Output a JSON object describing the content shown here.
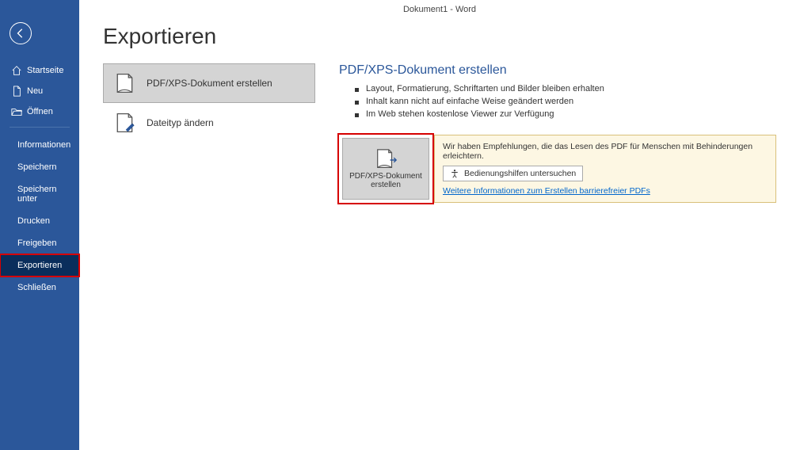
{
  "titlebar": "Dokument1  -  Word",
  "page_title": "Exportieren",
  "sidebar": {
    "top": {
      "home": "Startseite",
      "new": "Neu",
      "open": "Öffnen"
    },
    "items": [
      "Informationen",
      "Speichern",
      "Speichern unter",
      "Drucken",
      "Freigeben",
      "Exportieren",
      "Schließen"
    ]
  },
  "options": {
    "pdfxps": "PDF/XPS-Dokument erstellen",
    "changetype": "Dateityp ändern"
  },
  "right": {
    "title": "PDF/XPS-Dokument erstellen",
    "bullets": [
      "Layout, Formatierung, Schriftarten und Bilder bleiben erhalten",
      "Inhalt kann nicht auf einfache Weise geändert werden",
      "Im Web stehen kostenlose Viewer zur Verfügung"
    ],
    "big_button": "PDF/XPS-Dokument erstellen",
    "info": {
      "line": "Wir haben Empfehlungen, die das Lesen des PDF für Menschen mit Behinderungen erleichtern.",
      "button": "Bedienungshilfen untersuchen",
      "link": "Weitere Informationen zum Erstellen barrierefreier PDFs"
    }
  }
}
